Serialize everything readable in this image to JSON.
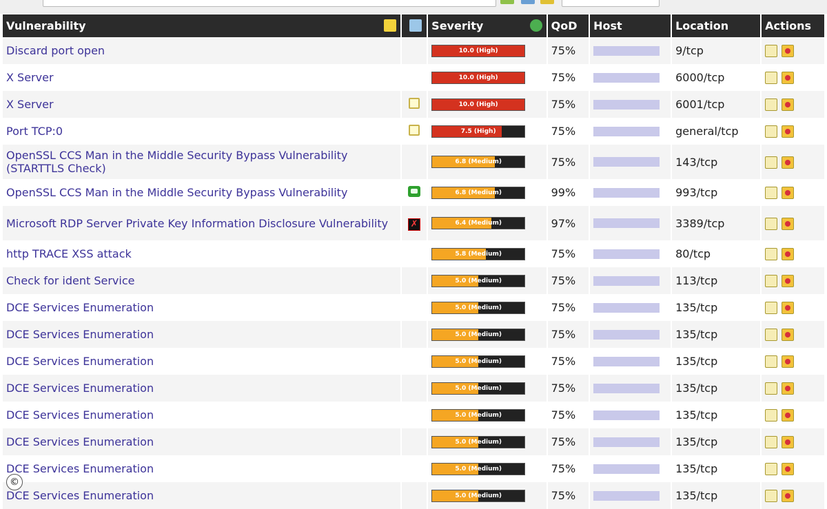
{
  "table": {
    "headers": {
      "vulnerability": "Vulnerability",
      "severity": "Severity",
      "qod": "QoD",
      "host": "Host",
      "location": "Location",
      "actions": "Actions"
    },
    "rows": [
      {
        "name": "Discard port open",
        "sev_label": "10.0 (High)",
        "sev_fraction": 1.0,
        "sev_color": "#d4321f",
        "qod": "75%",
        "location": "9/tcp",
        "flag": ""
      },
      {
        "name": "X Server",
        "sev_label": "10.0 (High)",
        "sev_fraction": 1.0,
        "sev_color": "#d4321f",
        "qod": "75%",
        "location": "6000/tcp",
        "flag": ""
      },
      {
        "name": "X Server",
        "sev_label": "10.0 (High)",
        "sev_fraction": 1.0,
        "sev_color": "#d4321f",
        "qod": "75%",
        "location": "6001/tcp",
        "flag": "note"
      },
      {
        "name": "Port TCP:0",
        "sev_label": "7.5 (High)",
        "sev_fraction": 0.75,
        "sev_color": "#d4321f",
        "qod": "75%",
        "location": "general/tcp",
        "flag": "note"
      },
      {
        "name": "OpenSSL CCS Man in the Middle Security Bypass Vulnerability (STARTTLS Check)",
        "sev_label": "6.8 (Medium)",
        "sev_fraction": 0.68,
        "sev_color": "#f5a623",
        "qod": "75%",
        "location": "143/tcp",
        "flag": ""
      },
      {
        "name": "OpenSSL CCS Man in the Middle Security Bypass Vulnerability",
        "sev_label": "6.8 (Medium)",
        "sev_fraction": 0.68,
        "sev_color": "#f5a623",
        "qod": "99%",
        "location": "993/tcp",
        "flag": "override"
      },
      {
        "name": "Microsoft RDP Server Private Key Information Disclosure Vulnerability",
        "sev_label": "6.4 (Medium)",
        "sev_fraction": 0.64,
        "sev_color": "#f5a623",
        "qod": "97%",
        "location": "3389/tcp",
        "flag": "false-positive"
      },
      {
        "name": "http TRACE XSS attack",
        "sev_label": "5.8 (Medium)",
        "sev_fraction": 0.58,
        "sev_color": "#f5a623",
        "qod": "75%",
        "location": "80/tcp",
        "flag": ""
      },
      {
        "name": "Check for ident Service",
        "sev_label": "5.0 (Medium)",
        "sev_fraction": 0.5,
        "sev_color": "#f5a623",
        "qod": "75%",
        "location": "113/tcp",
        "flag": ""
      },
      {
        "name": "DCE Services Enumeration",
        "sev_label": "5.0 (Medium)",
        "sev_fraction": 0.5,
        "sev_color": "#f5a623",
        "qod": "75%",
        "location": "135/tcp",
        "flag": ""
      },
      {
        "name": "DCE Services Enumeration",
        "sev_label": "5.0 (Medium)",
        "sev_fraction": 0.5,
        "sev_color": "#f5a623",
        "qod": "75%",
        "location": "135/tcp",
        "flag": ""
      },
      {
        "name": "DCE Services Enumeration",
        "sev_label": "5.0 (Medium)",
        "sev_fraction": 0.5,
        "sev_color": "#f5a623",
        "qod": "75%",
        "location": "135/tcp",
        "flag": ""
      },
      {
        "name": "DCE Services Enumeration",
        "sev_label": "5.0 (Medium)",
        "sev_fraction": 0.5,
        "sev_color": "#f5a623",
        "qod": "75%",
        "location": "135/tcp",
        "flag": ""
      },
      {
        "name": "DCE Services Enumeration",
        "sev_label": "5.0 (Medium)",
        "sev_fraction": 0.5,
        "sev_color": "#f5a623",
        "qod": "75%",
        "location": "135/tcp",
        "flag": ""
      },
      {
        "name": "DCE Services Enumeration",
        "sev_label": "5.0 (Medium)",
        "sev_fraction": 0.5,
        "sev_color": "#f5a623",
        "qod": "75%",
        "location": "135/tcp",
        "flag": ""
      },
      {
        "name": "DCE Services Enumeration",
        "sev_label": "5.0 (Medium)",
        "sev_fraction": 0.5,
        "sev_color": "#f5a623",
        "qod": "75%",
        "location": "135/tcp",
        "flag": ""
      },
      {
        "name": "DCE Services Enumeration",
        "sev_label": "5.0 (Medium)",
        "sev_fraction": 0.5,
        "sev_color": "#f5a623",
        "qod": "75%",
        "location": "135/tcp",
        "flag": ""
      }
    ]
  },
  "icons": {
    "header_vulnerability": "notes-filter-icon",
    "header_flags": "overrides-filter-icon",
    "header_severity": "sort-severity-icon",
    "row_actions": [
      "edit-note-icon",
      "delta-report-icon"
    ]
  },
  "copyright": "©"
}
